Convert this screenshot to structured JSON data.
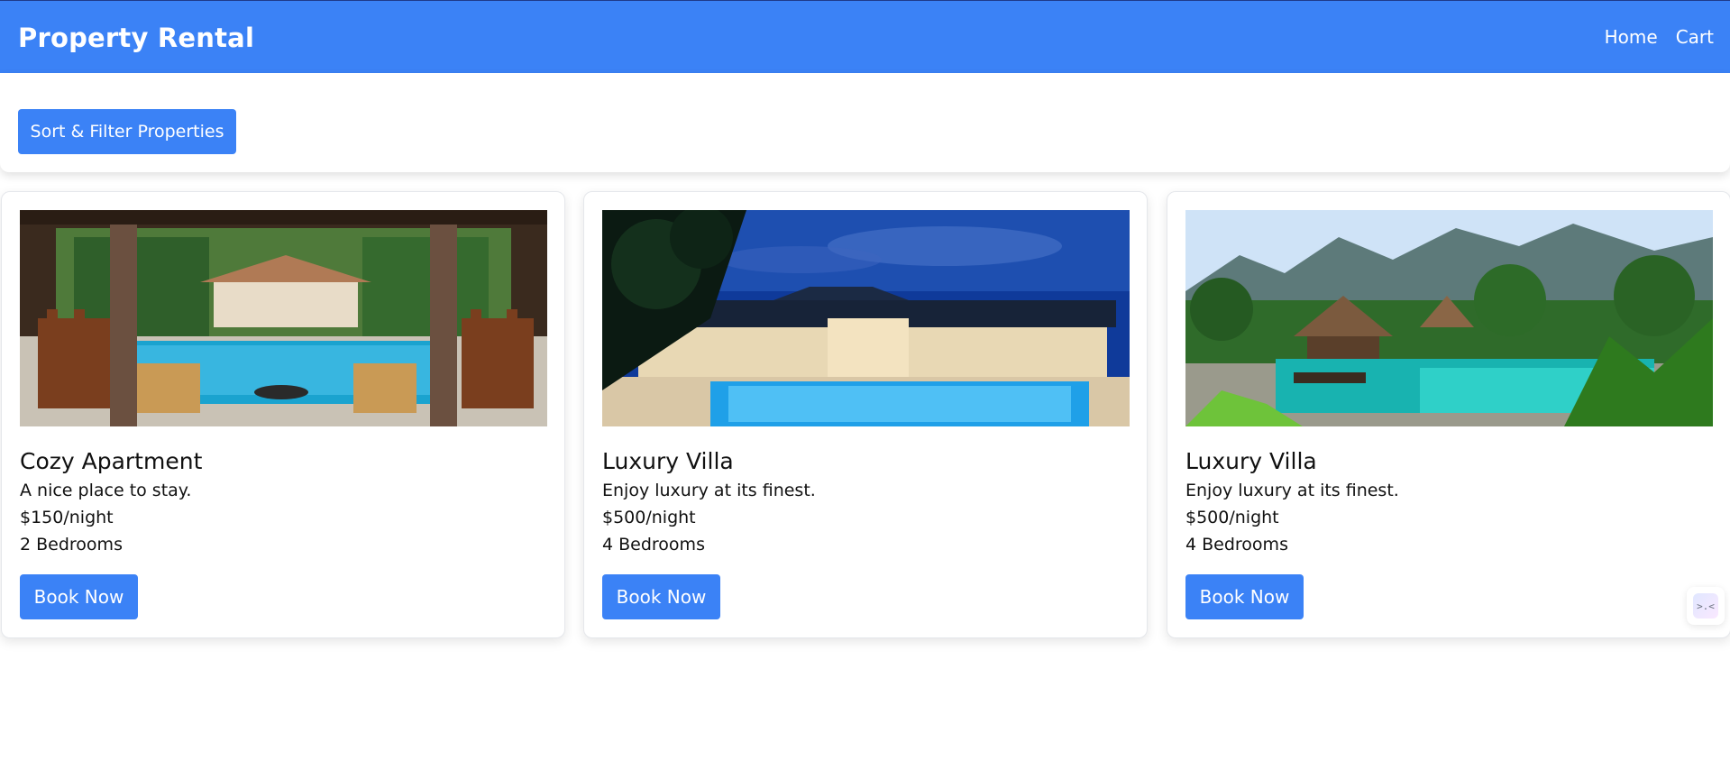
{
  "header": {
    "brand": "Property Rental",
    "nav": [
      {
        "label": "Home"
      },
      {
        "label": "Cart"
      }
    ]
  },
  "filter": {
    "button_label": "Sort & Filter Properties"
  },
  "properties": [
    {
      "title": "Cozy Apartment",
      "description": "A nice place to stay.",
      "price": "$150/night",
      "bedrooms": "2 Bedrooms",
      "book_label": "Book Now",
      "image": "pool-patio-photo"
    },
    {
      "title": "Luxury Villa",
      "description": "Enjoy luxury at its finest.",
      "price": "$500/night",
      "bedrooms": "4 Bedrooms",
      "book_label": "Book Now",
      "image": "night-pool-villa-photo"
    },
    {
      "title": "Luxury Villa",
      "description": "Enjoy luxury at its finest.",
      "price": "$500/night",
      "bedrooms": "4 Bedrooms",
      "book_label": "Book Now",
      "image": "tropical-resort-pool-photo"
    }
  ],
  "widget": {
    "glyph": ">.<"
  },
  "colors": {
    "primary": "#3b82f6",
    "header_border": "#1e3a8a"
  }
}
